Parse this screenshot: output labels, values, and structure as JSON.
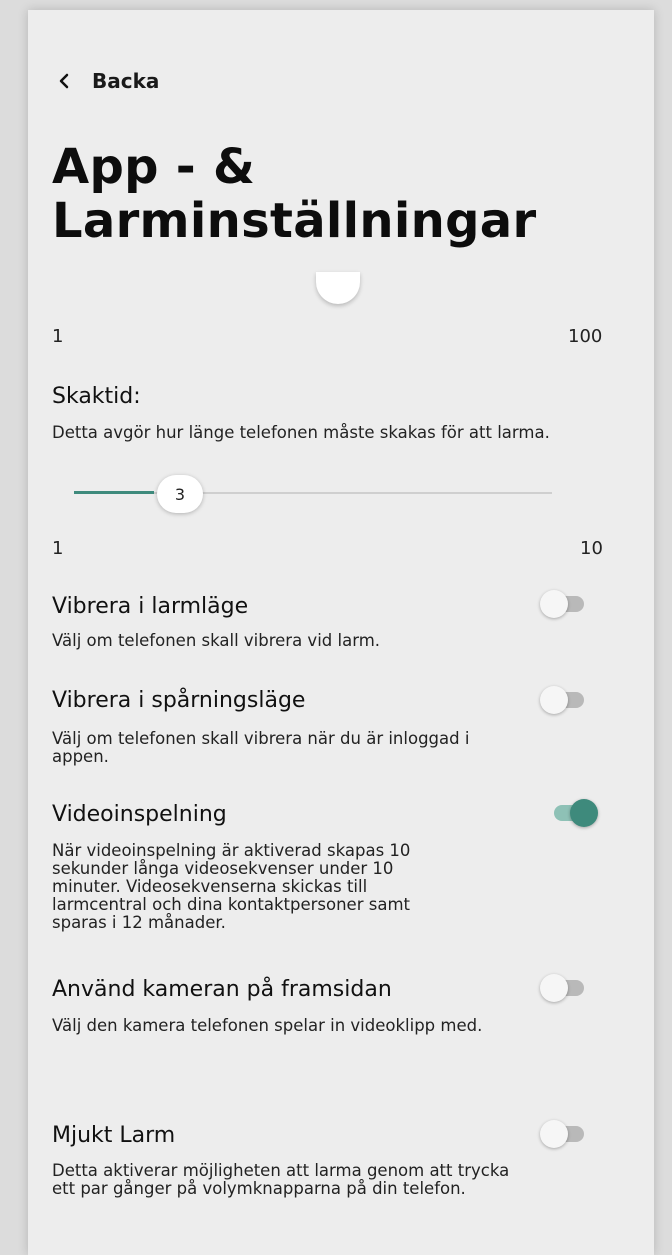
{
  "nav": {
    "back_label": "Backa"
  },
  "page": {
    "title_line1": "App - &",
    "title_line2": "Larminställningar"
  },
  "top_slider": {
    "min_label": "1",
    "max_label": "100"
  },
  "shake_time": {
    "title": "Skaktid:",
    "description": "Detta avgör hur länge telefonen måste skakas för att larma.",
    "value": "3",
    "min_label": "1",
    "max_label": "10"
  },
  "settings": [
    {
      "title": "Vibrera i larmläge",
      "description": "Välj om telefonen skall vibrera vid larm.",
      "enabled": false
    },
    {
      "title": "Vibrera i spårningsläge",
      "description": "Välj om telefonen skall vibrera när du är inloggad i appen.",
      "enabled": false
    },
    {
      "title": "Videoinspelning",
      "description": "När videoinspelning är aktiverad skapas 10 sekunder långa videosekvenser under 10 minuter. Videosekvenserna skickas till larmcentral och dina kontaktpersoner samt sparas i 12 månader.",
      "enabled": true
    },
    {
      "title": "Använd kameran på framsidan",
      "description": "Välj den kamera telefonen spelar in videoklipp med.",
      "enabled": false
    },
    {
      "title": "Mjukt Larm",
      "description": "Detta aktiverar möjligheten att larma genom att trycka ett par gånger på volymknapparna på din telefon.",
      "enabled": false
    }
  ],
  "colors": {
    "accent": "#3e8a7c",
    "background": "#ededed"
  },
  "icons": {
    "back": "chevron-left-icon"
  }
}
